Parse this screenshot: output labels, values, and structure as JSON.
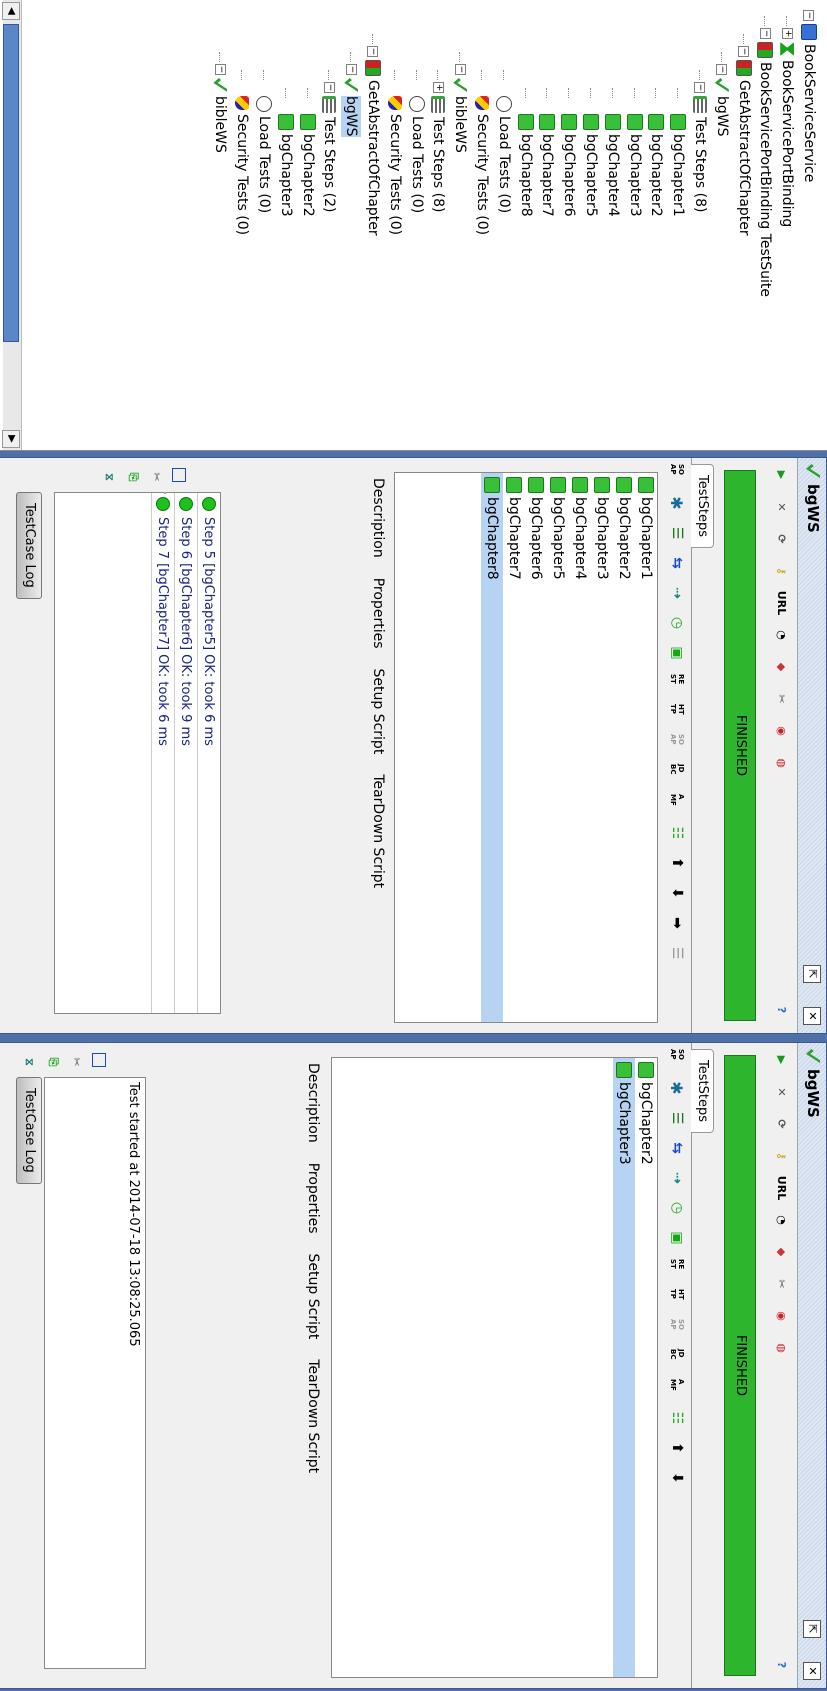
{
  "navigator": {
    "tree": [
      {
        "id": "n0",
        "label": "BookServiceService",
        "icon": "project-icon",
        "level": 0,
        "toggle": "−"
      },
      {
        "id": "n1",
        "label": "BookServicePortBinding",
        "icon": "interface-icon",
        "level": 1,
        "toggle": "+"
      },
      {
        "id": "n2",
        "label": "BookServicePortBinding TestSuite",
        "icon": "testsuite-icon",
        "level": 1,
        "toggle": "−"
      },
      {
        "id": "n3",
        "label": "GetAbstractOfChapter",
        "icon": "testsuite-icon",
        "level": 2,
        "toggle": "−"
      },
      {
        "id": "n4",
        "label": "bgWS",
        "icon": "testcase-icon",
        "level": 3,
        "toggle": "−"
      },
      {
        "id": "n5",
        "label": "Test Steps (8)",
        "icon": "teststeps-icon",
        "level": 4,
        "toggle": "−"
      },
      {
        "id": "n6",
        "label": "bgChapter1",
        "icon": "soap-step-icon",
        "level": 5
      },
      {
        "id": "n7",
        "label": "bgChapter2",
        "icon": "soap-step-icon",
        "level": 5
      },
      {
        "id": "n8",
        "label": "bgChapter3",
        "icon": "soap-step-icon",
        "level": 5
      },
      {
        "id": "n9",
        "label": "bgChapter4",
        "icon": "soap-step-icon",
        "level": 5
      },
      {
        "id": "n10",
        "label": "bgChapter5",
        "icon": "soap-step-icon",
        "level": 5
      },
      {
        "id": "n11",
        "label": "bgChapter6",
        "icon": "soap-step-icon",
        "level": 5
      },
      {
        "id": "n12",
        "label": "bgChapter7",
        "icon": "soap-step-icon",
        "level": 5
      },
      {
        "id": "n13",
        "label": "bgChapter8",
        "icon": "soap-step-icon",
        "level": 5
      },
      {
        "id": "n14",
        "label": "Load Tests (0)",
        "icon": "loadtest-icon",
        "level": 4
      },
      {
        "id": "n15",
        "label": "Security Tests (0)",
        "icon": "securitytest-icon",
        "level": 4
      },
      {
        "id": "n16",
        "label": "bibleWS",
        "icon": "testcase-icon",
        "level": 3,
        "toggle": "−"
      },
      {
        "id": "n17",
        "label": "Test Steps (8)",
        "icon": "teststeps-icon",
        "level": 4,
        "toggle": "+"
      },
      {
        "id": "n18",
        "label": "Load Tests (0)",
        "icon": "loadtest-icon",
        "level": 4
      },
      {
        "id": "n19",
        "label": "Security Tests (0)",
        "icon": "securitytest-icon",
        "level": 4
      },
      {
        "id": "n20",
        "label": "GetAbstractOfChapter",
        "icon": "testsuite-icon",
        "level": 2,
        "toggle": "−"
      },
      {
        "id": "n21",
        "label": "bgWS",
        "icon": "testcase-icon",
        "level": 3,
        "toggle": "−",
        "selected": true
      },
      {
        "id": "n22",
        "label": "Test Steps (2)",
        "icon": "teststeps-icon",
        "level": 4,
        "toggle": "−"
      },
      {
        "id": "n23",
        "label": "bgChapter2",
        "icon": "soap-step-icon",
        "level": 5
      },
      {
        "id": "n24",
        "label": "bgChapter3",
        "icon": "soap-step-icon",
        "level": 5
      },
      {
        "id": "n25",
        "label": "Load Tests (0)",
        "icon": "loadtest-icon",
        "level": 4
      },
      {
        "id": "n26",
        "label": "Security Tests (0)",
        "icon": "securitytest-icon",
        "level": 4
      },
      {
        "id": "n27",
        "label": "bibleWS",
        "icon": "testcase-icon",
        "level": 3,
        "toggle": "−"
      }
    ]
  },
  "testcase_windows": [
    {
      "title": "bgWS",
      "status": "FINISHED",
      "steps_tab": "TestSteps",
      "steps": [
        "bgChapter1",
        "bgChapter2",
        "bgChapter3",
        "bgChapter4",
        "bgChapter5",
        "bgChapter6",
        "bgChapter7",
        "bgChapter8"
      ],
      "selected_step": "bgChapter8",
      "subtabs": [
        "Description",
        "Properties",
        "Setup Script",
        "TearDown Script"
      ],
      "log": [
        "Step 5 [bgChapter5] OK: took 6 ms",
        "Step 6 [bgChapter6] OK: took 9 ms",
        "Step 7 [bgChapter7] OK: took 6 ms"
      ],
      "log_button": "TestCase Log"
    },
    {
      "title": "bgWS",
      "status": "FINISHED",
      "steps_tab": "TestSteps",
      "steps": [
        "bgChapter2",
        "bgChapter3"
      ],
      "selected_step": "bgChapter3",
      "subtabs": [
        "Description",
        "Properties",
        "Setup Script",
        "TearDown Script"
      ],
      "log": [
        "Test started at 2014-07-18 13:08:25.065"
      ],
      "log_button": "TestCase Log"
    }
  ],
  "toolbar_labels": {
    "url": "URL",
    "soap": "SO AP",
    "rest": "RE ST",
    "http": "HT TP",
    "jdbc": "JD BC",
    "amf": "A MF"
  },
  "colors": {
    "finished_bar": "#2eb52e",
    "selection": "#b7d3f4",
    "frame": "#4f6fa8"
  }
}
